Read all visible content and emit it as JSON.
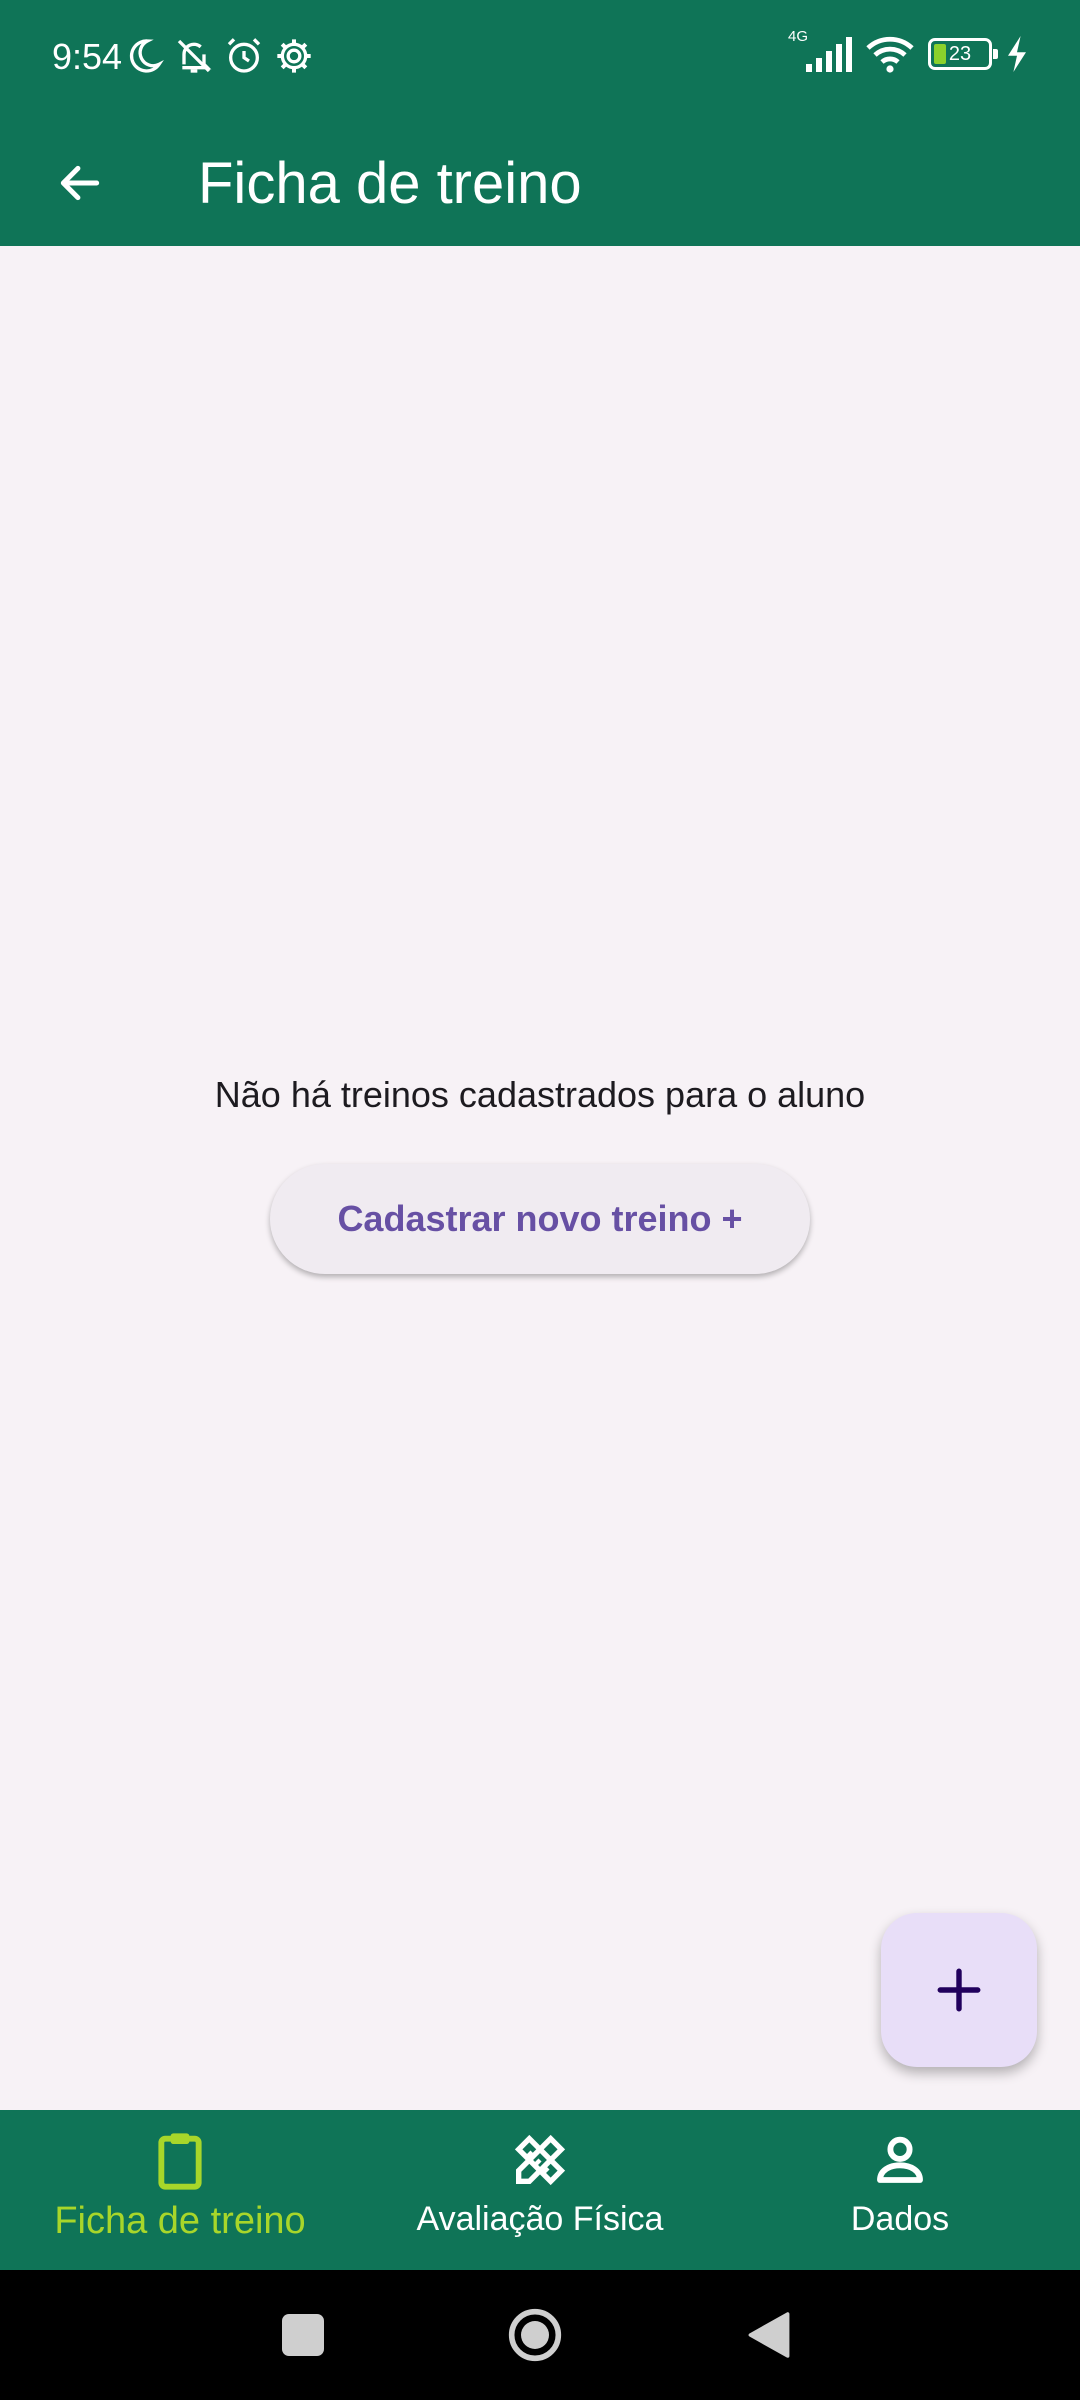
{
  "status_bar": {
    "time": "9:54",
    "network_type": "4G",
    "battery_level": "23",
    "battery_fraction": 0.23,
    "icons_left": [
      "moon-icon",
      "bell-off-icon",
      "alarm-icon",
      "settings-icon"
    ],
    "icons_right": [
      "signal-icon",
      "wifi-icon",
      "battery-icon",
      "charging-icon"
    ]
  },
  "app_bar": {
    "title": "Ficha de treino",
    "back_icon": "arrow-back-icon"
  },
  "content": {
    "empty_message": "Não há treinos cadastrados para o aluno",
    "cta_label": "Cadastrar novo treino +"
  },
  "fab": {
    "icon": "plus-icon"
  },
  "bottom_nav": {
    "items": [
      {
        "label": "Ficha de treino",
        "icon": "clipboard-icon",
        "active": true
      },
      {
        "label": "Avaliação Física",
        "icon": "ruler-pencil-icon",
        "active": false
      },
      {
        "label": "Dados",
        "icon": "person-icon",
        "active": false
      }
    ]
  },
  "system_nav": {
    "icons": [
      "recents-icon",
      "home-icon",
      "back-triangle-icon"
    ]
  },
  "colors": {
    "primary": "#0f7457",
    "background": "#f7f2f6",
    "active_nav": "#a8d62a",
    "button_text": "#6750a4",
    "fab_bg": "#e8def8"
  }
}
